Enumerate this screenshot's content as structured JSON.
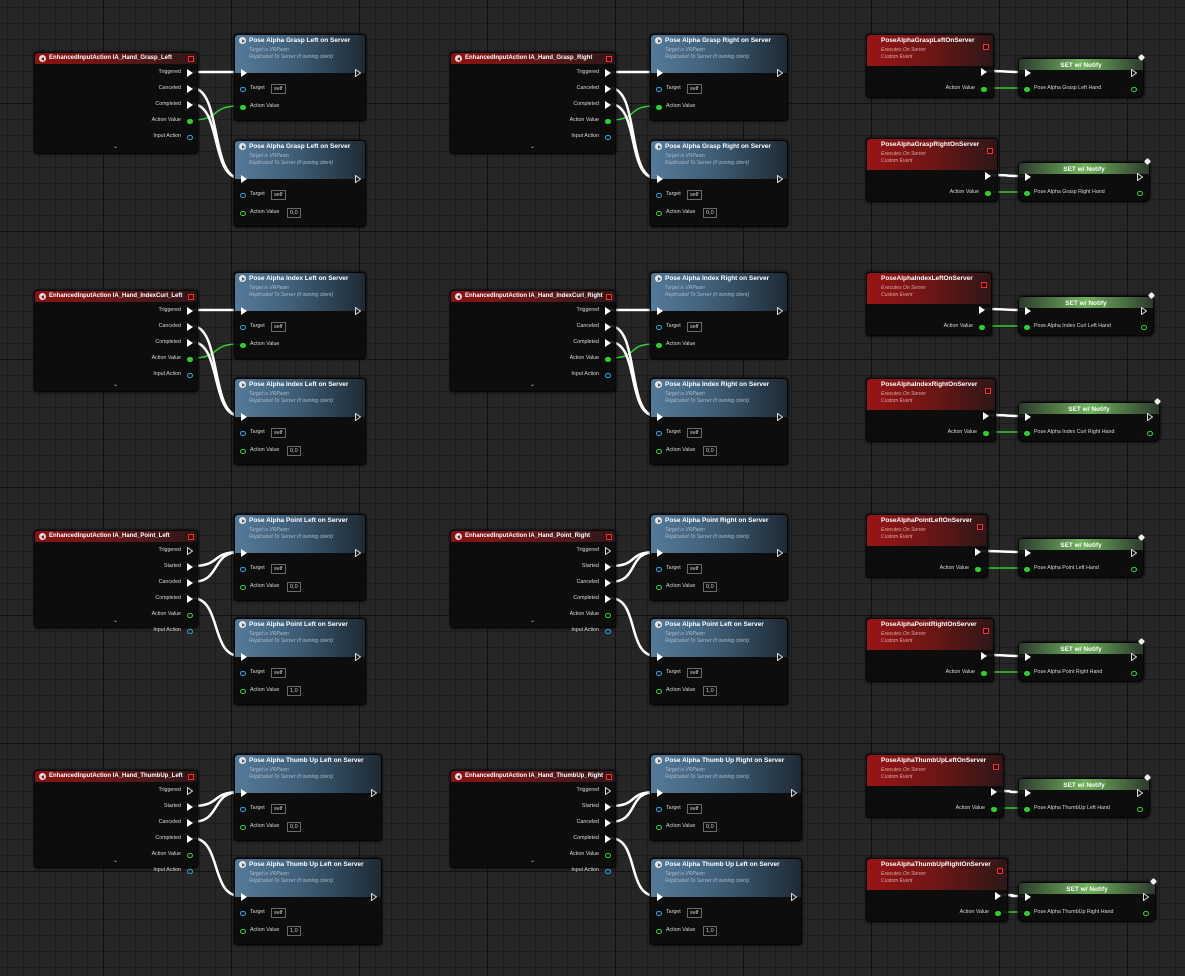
{
  "rows": [
    {
      "event": {
        "title": "EnhancedInputAction IA_Hand_Grasp_Left",
        "pins": [
          "Triggered",
          "Canceled",
          "Completed",
          "Action Value",
          "Input Action"
        ],
        "actionFilled": true
      },
      "fn1": {
        "title": "Pose Alpha Grasp Left on Server",
        "sub1": "Target is VRPawn",
        "sub2": "Replicated To Server (if owning client)",
        "target": "self",
        "av": "",
        "avFilled": true
      },
      "fn2": {
        "title": "Pose Alpha Grasp Left on Server",
        "sub1": "Target is VRPawn",
        "sub2": "Replicated To Server (if owning client)",
        "target": "self",
        "av": "0,0",
        "avFilled": false
      },
      "event2": {
        "title": "EnhancedInputAction IA_Hand_Grasp_Right",
        "pins": [
          "Triggered",
          "Canceled",
          "Completed",
          "Action Value",
          "Input Action"
        ],
        "actionFilled": true
      },
      "fn3": {
        "title": "Pose Alpha Grasp Right on Server",
        "sub1": "Target is VRPawn",
        "sub2": "Replicated To Server (if owning client)",
        "target": "self",
        "av": "",
        "avFilled": true
      },
      "fn4": {
        "title": "Pose Alpha Grasp Right on Server",
        "sub1": "Target is VRPawn",
        "sub2": "Replicated To Server (if owning client)",
        "target": "self",
        "av": "0,0",
        "avFilled": false
      },
      "custom1": {
        "title": "PoseAlphaGraspLeftOnServer",
        "sub1": "Executes On Server",
        "sub2": "Custom Event",
        "pin": "Action Value"
      },
      "set1": {
        "title": "SET w/ Notify",
        "var": "Pose Alpha Grasp Left Hand"
      },
      "custom2": {
        "title": "PoseAlphaGraspRightOnServer",
        "sub1": "Executes On Server",
        "sub2": "Custom Event",
        "pin": "Action Value"
      },
      "set2": {
        "title": "SET w/ Notify",
        "var": "Pose Alpha Grasp Right Hand"
      }
    },
    {
      "event": {
        "title": "EnhancedInputAction IA_Hand_IndexCurl_Left",
        "pins": [
          "Triggered",
          "Canceled",
          "Completed",
          "Action Value",
          "Input Action"
        ],
        "actionFilled": true
      },
      "fn1": {
        "title": "Pose Alpha Index Left on Server",
        "sub1": "Target is VRPawn",
        "sub2": "Replicated To Server (if owning client)",
        "target": "self",
        "av": "",
        "avFilled": true
      },
      "fn2": {
        "title": "Pose Alpha Index Left on Server",
        "sub1": "Target is VRPawn",
        "sub2": "Replicated To Server (if owning client)",
        "target": "self",
        "av": "0,0",
        "avFilled": false
      },
      "event2": {
        "title": "EnhancedInputAction IA_Hand_IndexCurl_Right",
        "pins": [
          "Triggered",
          "Canceled",
          "Completed",
          "Action Value",
          "Input Action"
        ],
        "actionFilled": true
      },
      "fn3": {
        "title": "Pose Alpha Index Right on Server",
        "sub1": "Target is VRPawn",
        "sub2": "Replicated To Server (if owning client)",
        "target": "self",
        "av": "",
        "avFilled": true
      },
      "fn4": {
        "title": "Pose Alpha Index Right on Server",
        "sub1": "Target is VRPawn",
        "sub2": "Replicated To Server (if owning client)",
        "target": "self",
        "av": "0,0",
        "avFilled": false
      },
      "custom1": {
        "title": "PoseAlphaIndexLeftOnServer",
        "sub1": "Executes On Server",
        "sub2": "Custom Event",
        "pin": "Action Value"
      },
      "set1": {
        "title": "SET w/ Notify",
        "var": "Pose Alpha Index Curl Left Hand"
      },
      "custom2": {
        "title": "PoseAlphaIndexRightOnServer",
        "sub1": "Executes On Server",
        "sub2": "Custom Event",
        "pin": "Action Value"
      },
      "set2": {
        "title": "SET w/ Notify",
        "var": "Pose Alpha Index Curl Right Hand"
      }
    },
    {
      "event": {
        "title": "EnhancedInputAction IA_Hand_Point_Left",
        "pins": [
          "Triggered",
          "Started",
          "Canceled",
          "Completed",
          "Action Value",
          "Input Action"
        ],
        "actionFilled": false
      },
      "fn1": {
        "title": "Pose Alpha Point Left on Server",
        "sub1": "Target is VRPawn",
        "sub2": "Replicated To Server (if owning client)",
        "target": "self",
        "av": "0,0",
        "avFilled": false
      },
      "fn2": {
        "title": "Pose Alpha Point Left on Server",
        "sub1": "Target is VRPawn",
        "sub2": "Replicated To Server (if owning client)",
        "target": "self",
        "av": "1,0",
        "avFilled": false
      },
      "event2": {
        "title": "EnhancedInputAction IA_Hand_Point_Right",
        "pins": [
          "Triggered",
          "Started",
          "Canceled",
          "Completed",
          "Action Value",
          "Input Action"
        ],
        "actionFilled": false
      },
      "fn3": {
        "title": "Pose Alpha Point Right on Server",
        "sub1": "Target is VRPawn",
        "sub2": "Replicated To Server (if owning client)",
        "target": "self",
        "av": "0,0",
        "avFilled": false
      },
      "fn4": {
        "title": "Pose Alpha Point Left on Server",
        "sub1": "Target is VRPawn",
        "sub2": "Replicated To Server (if owning client)",
        "target": "self",
        "av": "1,0",
        "avFilled": false
      },
      "custom1": {
        "title": "PoseAlphaPointLeftOnServer",
        "sub1": "Executes On Server",
        "sub2": "Custom Event",
        "pin": "Action Value"
      },
      "set1": {
        "title": "SET w/ Notify",
        "var": "Pose Alpha Point Left Hand"
      },
      "custom2": {
        "title": "PoseAlphaPointRightOnServer",
        "sub1": "Executes On Server",
        "sub2": "Custom Event",
        "pin": "Action Value"
      },
      "set2": {
        "title": "SET w/ Notify",
        "var": "Pose Alpha Point Right Hand"
      }
    },
    {
      "event": {
        "title": "EnhancedInputAction IA_Hand_ThumbUp_Left",
        "pins": [
          "Triggered",
          "Started",
          "Canceled",
          "Completed",
          "Action Value",
          "Input Action"
        ],
        "actionFilled": false
      },
      "fn1": {
        "title": "Pose Alpha Thumb Up Left on Server",
        "sub1": "Target is VRPawn",
        "sub2": "Replicated To Server (if owning client)",
        "target": "self",
        "av": "0,0",
        "avFilled": false
      },
      "fn2": {
        "title": "Pose Alpha Thumb Up Left on Server",
        "sub1": "Target is VRPawn",
        "sub2": "Replicated To Server (if owning client)",
        "target": "self",
        "av": "1,0",
        "avFilled": false
      },
      "event2": {
        "title": "EnhancedInputAction IA_Hand_ThumbUp_Right",
        "pins": [
          "Triggered",
          "Started",
          "Canceled",
          "Completed",
          "Action Value",
          "Input Action"
        ],
        "actionFilled": false
      },
      "fn3": {
        "title": "Pose Alpha Thumb Up Right on Server",
        "sub1": "Target is VRPawn",
        "sub2": "Replicated To Server (if owning client)",
        "target": "self",
        "av": "0,0",
        "avFilled": false
      },
      "fn4": {
        "title": "Pose Alpha Thumb Up Left on Server",
        "sub1": "Target is VRPawn",
        "sub2": "Replicated To Server (if owning client)",
        "target": "self",
        "av": "1,0",
        "avFilled": false
      },
      "custom1": {
        "title": "PoseAlphaThumbUpLeftOnServer",
        "sub1": "Executes On Server",
        "sub2": "Custom Event",
        "pin": "Action Value"
      },
      "set1": {
        "title": "SET w/ Notify",
        "var": "Pose Alpha ThumbUp Left Hand"
      },
      "custom2": {
        "title": "PoseAlphaThumbUpRightOnServer",
        "sub1": "Executes On Server",
        "sub2": "Custom Event",
        "pin": "Action Value"
      },
      "set2": {
        "title": "SET w/ Notify",
        "var": "Pose Alpha ThumbUp Right Hand"
      }
    }
  ],
  "labels": {
    "target": "Target",
    "actionValue": "Action Value"
  },
  "colors": {
    "exec": "#ffffff",
    "float": "#2ed12e",
    "object": "#27a6e0",
    "eventHeader": "#8c1212",
    "functionHeader": "#557a9a",
    "setHeader": "#6fb35c"
  }
}
